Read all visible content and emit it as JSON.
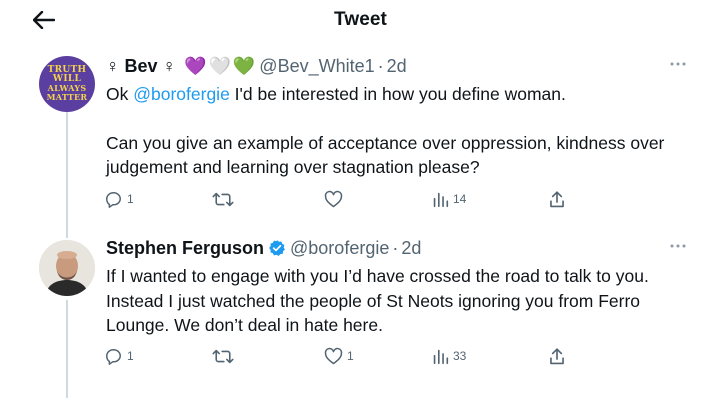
{
  "header": {
    "title": "Tweet"
  },
  "tweets": [
    {
      "display_name_prefix": "♀ Bev ♀",
      "emojis": [
        "💜",
        "🤍",
        "💚"
      ],
      "handle": "@Bev_White1",
      "time": "2d",
      "avatar_text": [
        "TRUTH",
        "WILL",
        "ALWAYS",
        "MATTER"
      ],
      "mention": "@borofergie",
      "text_after_mention": " I'd be interested in how you define woman.",
      "text_prefix": "Ok ",
      "paragraph_2": "Can you give an example of acceptance over oppression, kindness over judgement and learning over stagnation please?",
      "counts": {
        "replies": "1",
        "retweets": "",
        "likes": "",
        "views": "14"
      }
    },
    {
      "display_name": "Stephen Ferguson",
      "handle": "@borofergie",
      "time": "2d",
      "verified": true,
      "text": "If I wanted to engage with you I’d have crossed the road to talk to you. Instead I just watched the people of St Neots ignoring you from Ferro Lounge. We don’t deal in hate here.",
      "counts": {
        "replies": "1",
        "retweets": "",
        "likes": "1",
        "views": "33"
      }
    }
  ],
  "colors": {
    "accent": "#1d9bf0",
    "muted": "#536471",
    "text": "#0f1419",
    "thread_line": "#cfd9de"
  }
}
